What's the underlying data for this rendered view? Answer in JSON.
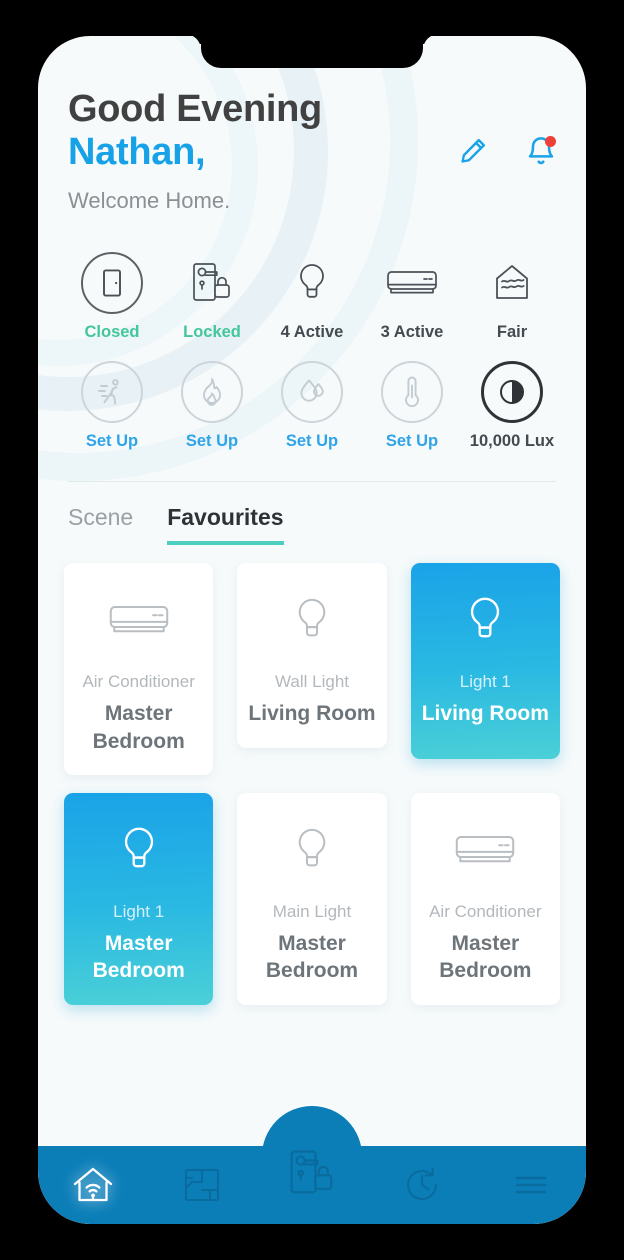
{
  "header": {
    "greeting": "Good Evening",
    "user_name": "Nathan,",
    "subtitle": "Welcome Home.",
    "edit_icon": "pencil-icon",
    "notification_icon": "bell-icon",
    "has_notification": true,
    "accent_blue": "#17a2e8",
    "badge_color": "#ec4038"
  },
  "status": {
    "row1": [
      {
        "icon": "door-icon",
        "label": "Closed",
        "state": "green"
      },
      {
        "icon": "door-lock-icon",
        "label": "Locked",
        "state": "green"
      },
      {
        "icon": "bulb-icon",
        "label": "4 Active",
        "state": "dark"
      },
      {
        "icon": "air-conditioner-icon",
        "label": "3 Active",
        "state": "dark"
      },
      {
        "icon": "air-quality-house-icon",
        "label": "Fair",
        "state": "dark"
      }
    ],
    "row2": [
      {
        "icon": "motion-sensor-icon",
        "label": "Set Up",
        "state": "blue"
      },
      {
        "icon": "flame-icon",
        "label": "Set Up",
        "state": "blue"
      },
      {
        "icon": "humidity-icon",
        "label": "Set Up",
        "state": "blue"
      },
      {
        "icon": "thermometer-icon",
        "label": "Set Up",
        "state": "blue"
      },
      {
        "icon": "brightness-icon",
        "label": "10,000 Lux",
        "state": "dark"
      }
    ],
    "green_color": "#43c69a",
    "blue_color": "#2fa4e8"
  },
  "tabs": {
    "items": [
      {
        "label": "Scene",
        "active": false
      },
      {
        "label": "Favourites",
        "active": true
      }
    ],
    "active_underline_color": "#4ccfbf"
  },
  "devices": {
    "row1": [
      {
        "icon": "air-conditioner-icon",
        "name": "Air Conditioner",
        "room": "Master Bedroom",
        "on": false
      },
      {
        "icon": "bulb-icon",
        "name": "Wall Light",
        "room": "Living Room",
        "on": false
      },
      {
        "icon": "bulb-icon",
        "name": "Light 1",
        "room": "Living Room",
        "on": true
      }
    ],
    "row2": [
      {
        "icon": "bulb-icon",
        "name": "Light 1",
        "room": "Master Bedroom",
        "on": true
      },
      {
        "icon": "bulb-icon",
        "name": "Main Light",
        "room": "Master Bedroom",
        "on": false
      },
      {
        "icon": "air-conditioner-icon",
        "name": "Air Conditioner",
        "room": "Master Bedroom",
        "on": false
      }
    ],
    "on_gradient_from": "#1aa3e8",
    "on_gradient_to": "#4bd0d7"
  },
  "bottom_nav": {
    "background": "#0b7eb8",
    "items": [
      {
        "icon": "home-wifi-icon",
        "active": true
      },
      {
        "icon": "floorplan-icon",
        "active": false
      },
      {
        "icon": "door-lock-icon",
        "active": false,
        "elevated": true
      },
      {
        "icon": "history-clock-icon",
        "active": false
      },
      {
        "icon": "menu-icon",
        "active": false
      }
    ]
  }
}
